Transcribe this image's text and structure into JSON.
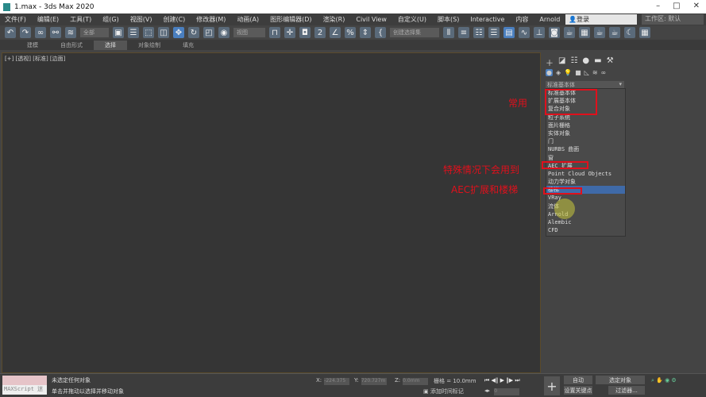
{
  "title": "1.max - 3ds Max 2020",
  "menu": [
    "文件(F)",
    "编辑(E)",
    "工具(T)",
    "组(G)",
    "视图(V)",
    "创建(C)",
    "修改器(M)",
    "动画(A)",
    "图形编辑器(D)",
    "渲染(R)",
    "Civil View",
    "自定义(U)",
    "脚本(S)",
    "Interactive",
    "内容",
    "Arnold"
  ],
  "login": "登录",
  "workspace": "工作区: 默认",
  "toolbar": {
    "filter": "全部",
    "ref_coord": "视图",
    "selset": "创建选择集"
  },
  "ribbon": [
    "建模",
    "自由形式",
    "选择",
    "对象绘制",
    "填充"
  ],
  "viewport_label": "[+] [透视] [标准] [边面]",
  "panel": {
    "combo": "标准基本体",
    "items": [
      "标准基本体",
      "扩展基本体",
      "复合对象",
      "粒子系统",
      "面片栅格",
      "实体对象",
      "门",
      "NURBS 曲面",
      "窗",
      "AEC 扩展",
      "Point Cloud Objects",
      "动力学对象",
      "楼梯",
      "VRay",
      "流体",
      "Arnold",
      "Alembic",
      "CFD"
    ],
    "highlight": 12
  },
  "notes": {
    "common": "常用",
    "special": "特殊情况下会用到",
    "aec": "AEC扩展和楼梯"
  },
  "status": {
    "maxscript": "MAXScript 迷",
    "line1": "未选定任何对象",
    "line2": "单击并拖动以选择并移动对象",
    "x_label": "X:",
    "x": "-224.375",
    "y_label": "Y:",
    "y": "720.727m",
    "z_label": "Z:",
    "z": "0.0mm",
    "grid": "栅格 = 10.0mm",
    "add_tag": "添加时间标记",
    "frame": "0",
    "auto": "自动",
    "sel_obj": "选定对象",
    "set_key": "设置关键点",
    "filters": "过滤器..."
  }
}
